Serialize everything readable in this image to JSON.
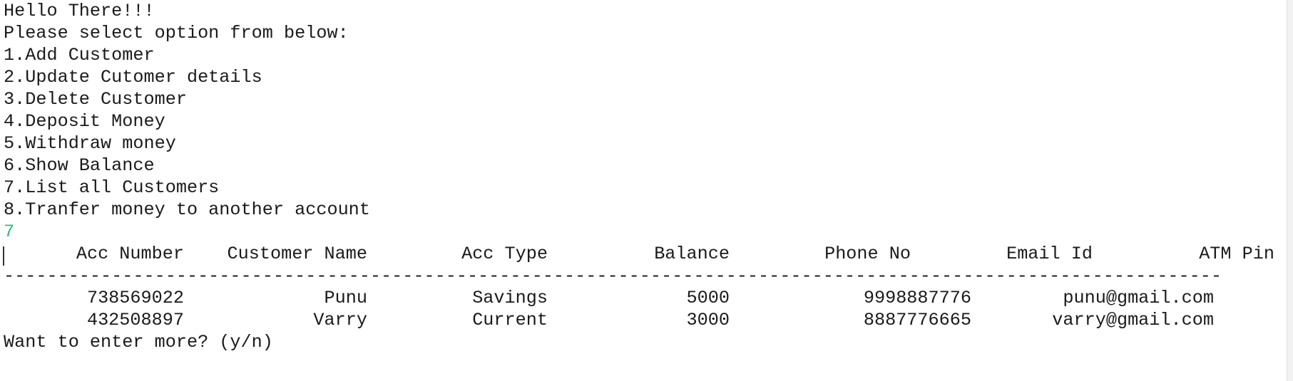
{
  "console": {
    "greeting": "Hello There!!!",
    "prompt": "Please select option from below:",
    "menu_items": [
      "1.Add Customer",
      "2.Update Cutomer details",
      "3.Delete Customer",
      "4.Deposit Money",
      "5.Withdraw money",
      "6.Show Balance",
      "7.List all Customers",
      "8.Tranfer money to another account"
    ],
    "user_input": "7",
    "input_color": "#2fbf71",
    "table": {
      "headers": [
        "Acc Number",
        "Customer Name",
        "Acc Type",
        "Balance",
        "Phone No",
        "Email Id",
        "ATM Pin"
      ],
      "divider": "-----------------------------------------------------------------------------------------------------------------",
      "rows": [
        {
          "acc": "738569022",
          "name": "Punu",
          "type": "Savings",
          "balance": "5000",
          "phone": "9998887776",
          "email": "punu@gmail.com"
        },
        {
          "acc": "432508897",
          "name": "Varry",
          "type": "Current",
          "balance": "3000",
          "phone": "8887776665",
          "email": "varry@gmail.com"
        }
      ]
    },
    "continue_prompt": "Want to enter more? (y/n)"
  }
}
